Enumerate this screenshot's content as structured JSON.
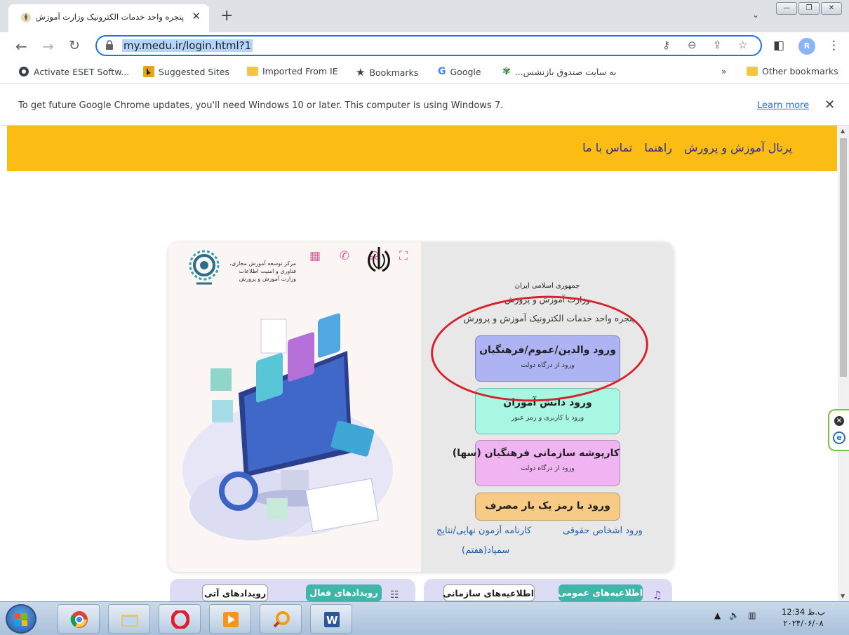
{
  "browser": {
    "tab_title": "پنجره واحد خدمات الکترونیک وزارت آموزش",
    "new_tab_label": "+",
    "url": "my.medu.ir/login.html?1",
    "profile_initial": "R",
    "bookmarks": [
      {
        "label": "Activate ESET Softw...",
        "icon": "eset-icon"
      },
      {
        "label": "Suggested Sites",
        "icon": "bing-icon"
      },
      {
        "label": "Imported From IE",
        "icon": "folder-icon"
      },
      {
        "label": "Bookmarks",
        "icon": "star-icon"
      },
      {
        "label": "Google",
        "icon": "google-icon"
      },
      {
        "label": "به سایت صندوق بازنشس...",
        "icon": "fund-icon"
      }
    ],
    "more_bookmarks": "»",
    "other_bookmarks": "Other bookmarks",
    "infobar": {
      "message": "To get future Google Chrome updates, you'll need Windows 10 or later. This computer is using Windows 7.",
      "link": "Learn more",
      "close": "✕"
    }
  },
  "site": {
    "nav": {
      "portal": "پرتال آموزش و پرورش",
      "guide": "راهنما",
      "contact": "تماس با ما"
    },
    "org": {
      "line1": "جمهوری اسلامی ایران",
      "line2": "وزارت آموزش و پرورش",
      "line3": "پنجره واحد خدمات الکترونیک آموزش و پرورش"
    },
    "logo_text": [
      "مرکز توسعه آموزش مجازی،",
      "فناوری و امنیت اطلاعات",
      "وزارت آموزش و پرورش"
    ],
    "buttons": {
      "parents": {
        "main": "ورود والدین/عموم/فرهنگیان",
        "sub": "ورود از درگاه دولت"
      },
      "student": {
        "main": "ورود دانش آموزان",
        "sub": "ورود با کاربری و رمز عبور"
      },
      "saha": {
        "main": "کارپوشه سازمانی فرهنگیان (سها)",
        "sub": "ورود از درگاه دولت"
      },
      "otp": {
        "main": "ورود با رمز یک بار مصرف"
      }
    },
    "links": {
      "legal": "ورود اشخاص حقوقی",
      "report_card": "کارنامه آزمون نهایی/نتایج",
      "sampad": "سمپاد(هفتم)"
    },
    "tabs": {
      "public": "اطلاعیه‌های عمومی",
      "org": "اطلاعیه‌های سازمانی",
      "active": "رویدادهای فعال",
      "upcoming": "رویدادهای آتی"
    }
  },
  "taskbar": {
    "time": "12:34 ب.ظ",
    "date": "۲۰۲۴/۰۶/۰۸"
  }
}
